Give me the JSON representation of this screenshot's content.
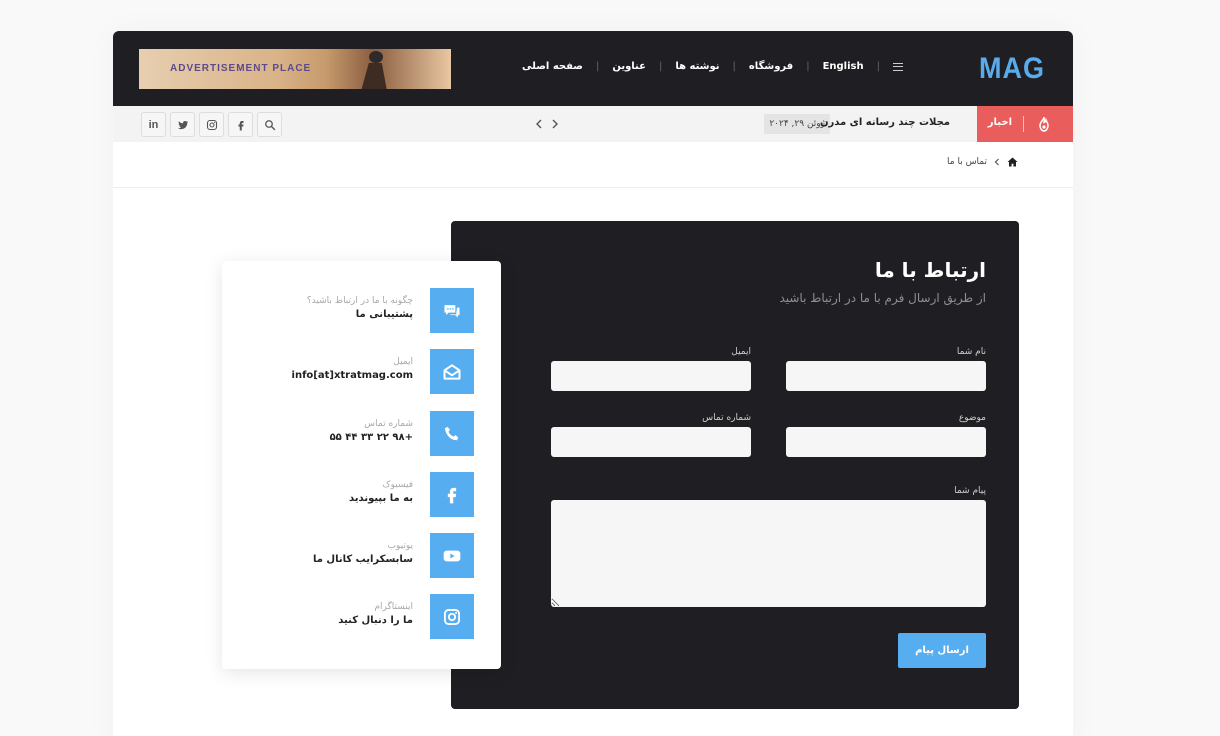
{
  "colors": {
    "accent": "#56aef0",
    "dark": "#1f1f23",
    "news_red": "#ea5d5d"
  },
  "header": {
    "logo": "MAG",
    "ad_text": "ADVERTISEMENT PLACE",
    "nav": [
      {
        "label": "صفحه اصلی"
      },
      {
        "label": "عناوین"
      },
      {
        "label": "نوشته ها"
      },
      {
        "label": "فروشگاه"
      },
      {
        "label": "English"
      }
    ],
    "menu_icon": "hamburger-icon"
  },
  "newsbar": {
    "label": "اخبار",
    "title": "مجلات چند رسانه ای مدرن",
    "date": "ژوئن ۲۹, ۲۰۲۴",
    "icons": [
      "fire-icon",
      "chevron-left-icon",
      "chevron-right-icon"
    ],
    "social_icons": [
      "linkedin-icon",
      "twitter-icon",
      "instagram-icon",
      "facebook-icon",
      "search-icon"
    ]
  },
  "breadcrumb": {
    "current": "تماس با ما",
    "icon": "home-icon"
  },
  "form": {
    "title": "ارتباط با ما",
    "subtitle": "از طریق ارسال فرم با ما در ارتباط باشید",
    "name_label": "نام شما",
    "email_label": "ایمیل",
    "subject_label": "موضوع",
    "phone_label": "شماره تماس",
    "message_label": "پیام شما",
    "submit_label": "ارسال پیام"
  },
  "contact": [
    {
      "sub": "چگونه با ما در ارتباط باشید؟",
      "main": "پشتیبانی ما",
      "icon": "chat-icon"
    },
    {
      "sub": "ایمیل",
      "main": "info[at]xtratmag.com",
      "icon": "envelope-icon"
    },
    {
      "sub": "شماره تماس",
      "main": "+۹۸ ۲۲ ۳۳ ۴۴ ۵۵",
      "icon": "phone-icon"
    },
    {
      "sub": "فیسبوک",
      "main": "به ما بپیوندید",
      "icon": "facebook-icon"
    },
    {
      "sub": "یوتیوب",
      "main": "سابسکرایب کانال ما",
      "icon": "youtube-icon"
    },
    {
      "sub": "اینستاگرام",
      "main": "ما را دنبال کنید",
      "icon": "instagram-icon"
    }
  ]
}
